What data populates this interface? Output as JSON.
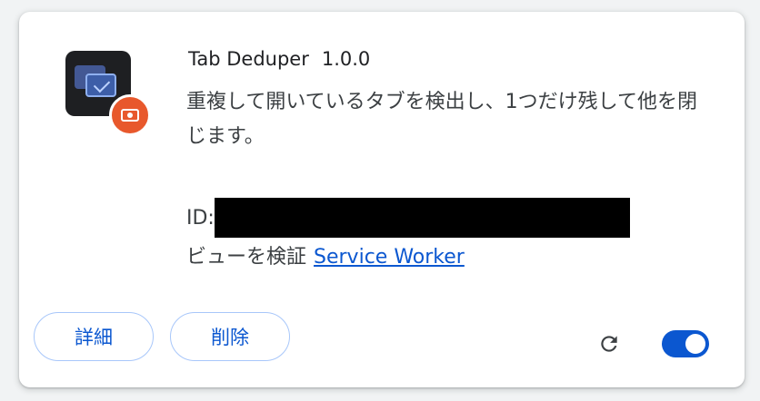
{
  "extension": {
    "name": "Tab Deduper",
    "version": "1.0.0",
    "description": "重複して開いているタブを検出し、1つだけ残して他を閉じます。",
    "id_label": "ID:",
    "views_label": "ビューを検証",
    "service_worker_link": "Service Worker",
    "enabled": true
  },
  "buttons": {
    "details": "詳細",
    "remove": "削除"
  },
  "icons": {
    "extension": "tab-deduper-icon",
    "badge": "unpacked-extension-badge-icon",
    "reload": "reload-icon",
    "toggle": "enable-toggle"
  },
  "colors": {
    "accent": "#0b57d0",
    "button_border": "#a8c7fa",
    "badge": "#e8582c",
    "icon_bg": "#1e1f22"
  }
}
